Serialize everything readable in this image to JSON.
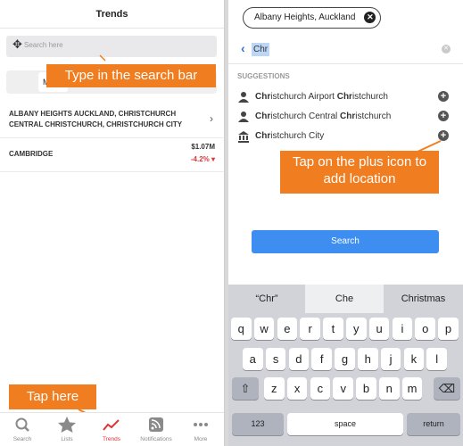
{
  "left": {
    "title": "Trends",
    "search_placeholder": "Search here",
    "segment_selected": "M",
    "results": [
      {
        "line1": "ALBANY HEIGHTS AUCKLAND, CHRISTCHURCH",
        "line2": "CENTRAL CHRISTCHURCH, CHRISTCHURCH CITY"
      },
      {
        "name": "CAMBRIDGE",
        "price": "$1.07M",
        "change": "-4.2% ▾"
      }
    ],
    "tabs": [
      {
        "label": "Search",
        "icon": "search-icon"
      },
      {
        "label": "Lists",
        "icon": "star-icon"
      },
      {
        "label": "Trends",
        "icon": "trend-line-icon"
      },
      {
        "label": "Notifications",
        "icon": "rss-icon"
      },
      {
        "label": "More",
        "icon": "more-dots-icon"
      }
    ],
    "callout_search": "Type in the search bar",
    "callout_tab": "Tap here"
  },
  "right": {
    "chip_label": "Albany Heights, Auckland",
    "query": "Chr",
    "suggestions_header": "SUGGESTIONS",
    "suggestions": [
      {
        "pre": "",
        "b1": "Chr",
        "mid": "istchurch Airport ",
        "b2": "Chr",
        "post": "istchurch",
        "icon": "person-pin-icon"
      },
      {
        "pre": "",
        "b1": "Chr",
        "mid": "istchurch Central ",
        "b2": "Chr",
        "post": "istchurch",
        "icon": "person-pin-icon"
      },
      {
        "pre": "",
        "b1": "Chr",
        "mid": "istchurch City",
        "b2": "",
        "post": "",
        "icon": "building-icon"
      }
    ],
    "callout_plus": "Tap on the plus icon to add location",
    "search_button": "Search",
    "predictions": [
      "“Chr”",
      "Che",
      "Christmas"
    ],
    "keys_row1": [
      "q",
      "w",
      "e",
      "r",
      "t",
      "y",
      "u",
      "i",
      "o",
      "p"
    ],
    "keys_row2": [
      "a",
      "s",
      "d",
      "f",
      "g",
      "h",
      "j",
      "k",
      "l"
    ],
    "keys_row3": [
      "z",
      "x",
      "c",
      "v",
      "b",
      "n",
      "m"
    ],
    "key_123": "123",
    "key_space": "space",
    "key_return": "return"
  },
  "colors": {
    "accent": "#f07e20",
    "link": "#2f6fd6",
    "negative": "#d93a3a",
    "button": "#3d8ef0"
  }
}
